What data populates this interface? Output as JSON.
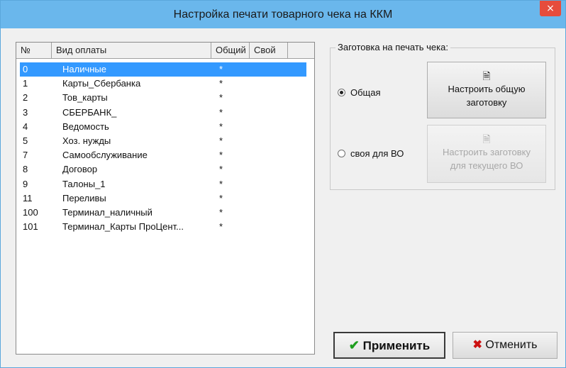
{
  "window": {
    "title": "Настройка печати товарного чека на ККМ",
    "close_glyph": "×"
  },
  "list": {
    "columns": [
      "№",
      "Вид оплаты",
      "Общий",
      "Свой"
    ],
    "rows": [
      {
        "num": "0",
        "name": "Наличные",
        "common": "*",
        "own": "",
        "selected": true
      },
      {
        "num": "1",
        "name": "Карты_Сбербанка",
        "common": "*",
        "own": ""
      },
      {
        "num": "2",
        "name": "Тов_карты",
        "common": "*",
        "own": ""
      },
      {
        "num": "3",
        "name": "СБЕРБАНК_",
        "common": "*",
        "own": ""
      },
      {
        "num": "4",
        "name": "Ведомость",
        "common": "*",
        "own": ""
      },
      {
        "num": "5",
        "name": "Хоз. нужды",
        "common": "*",
        "own": ""
      },
      {
        "num": "7",
        "name": "Самообслуживание",
        "common": "*",
        "own": ""
      },
      {
        "num": "8",
        "name": "Договор",
        "common": "*",
        "own": ""
      },
      {
        "num": "9",
        "name": "Талоны_1",
        "common": "*",
        "own": ""
      },
      {
        "num": "11",
        "name": "Переливы",
        "common": "*",
        "own": ""
      },
      {
        "num": "100",
        "name": "Терминал_наличный",
        "common": "*",
        "own": ""
      },
      {
        "num": "101",
        "name": "Терминал_Карты ПроЦент...",
        "common": "*",
        "own": ""
      }
    ]
  },
  "template_group": {
    "title": "Заготовка на печать чека:",
    "radio_common": {
      "label": "Общая",
      "checked": true
    },
    "radio_own": {
      "label": "своя для ВО",
      "checked": false
    },
    "btn_common": {
      "icon": "document-icon",
      "line1": "Настроить общую",
      "line2": "заготовку",
      "enabled": true
    },
    "btn_own": {
      "icon": "document-icon",
      "line1": "Настроить заготовку",
      "line2": "для текущего ВО",
      "enabled": false
    }
  },
  "footer": {
    "apply_label": "Применить",
    "cancel_label": "Отменить"
  },
  "colors": {
    "titlebar": "#6ab7ec",
    "close": "#e64c3c",
    "selection": "#3399ff",
    "apply_check": "#1e9e1e",
    "cancel_cross": "#cc1111"
  }
}
